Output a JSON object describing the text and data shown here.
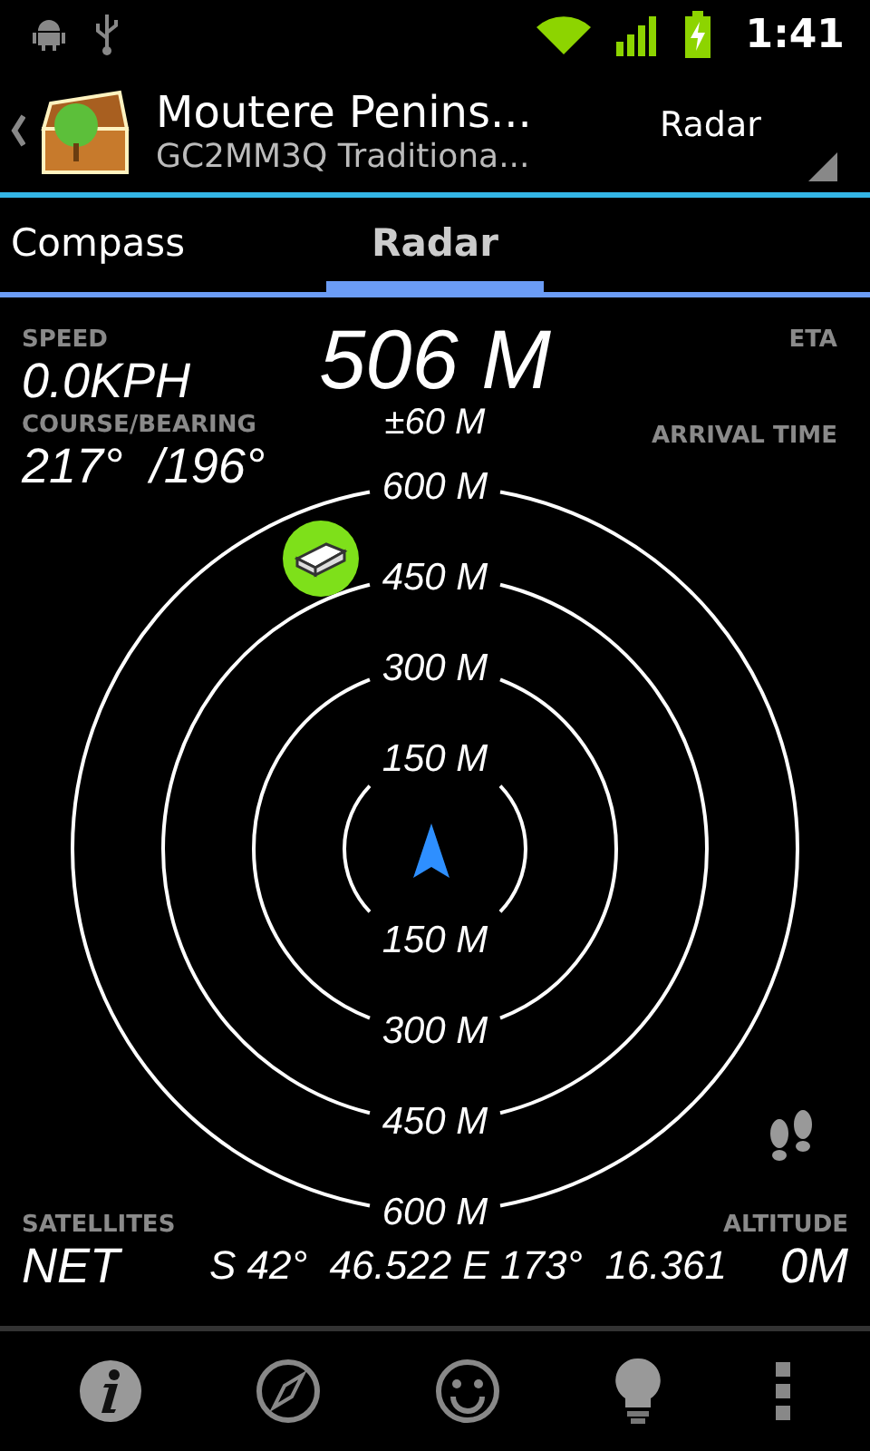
{
  "status_bar": {
    "time": "1:41"
  },
  "header": {
    "title": "Moutere Penins...",
    "subtitle": "GC2MM3Q Traditiona...",
    "view_spinner": "Radar"
  },
  "tabs": [
    {
      "label": "Compass",
      "selected": false
    },
    {
      "label": "Radar",
      "selected": true
    }
  ],
  "stats": {
    "speed": {
      "label": "SPEED",
      "value": "0.0KPH"
    },
    "distance": {
      "value": "506 M",
      "accuracy": "±60 M"
    },
    "eta": {
      "label": "ETA"
    },
    "course": {
      "label": "COURSE/BEARING",
      "value": "217°  /196°"
    },
    "arrival": {
      "label": "ARRIVAL TIME"
    },
    "satellites": {
      "label": "SATELLITES",
      "value": "NET"
    },
    "coordinates": "S 42°  46.522 E 173°  16.361",
    "altitude": {
      "label": "ALTITUDE",
      "value": "0M"
    }
  },
  "radar": {
    "range_labels": [
      "600 M",
      "450 M",
      "300 M",
      "150 M",
      "150 M",
      "300 M",
      "450 M",
      "600 M"
    ]
  }
}
